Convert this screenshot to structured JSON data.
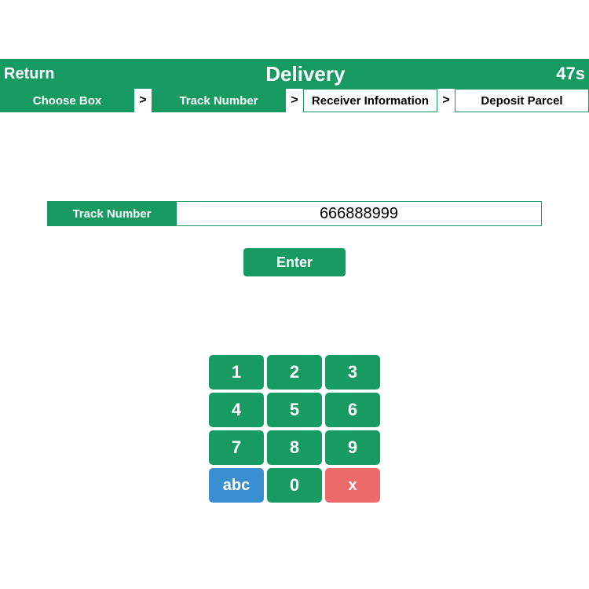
{
  "header": {
    "return_label": "Return",
    "title": "Delivery",
    "timer": "47s"
  },
  "breadcrumb": {
    "sep": ">",
    "steps": [
      {
        "label": "Choose Box",
        "state": "active"
      },
      {
        "label": "Track Number",
        "state": "active"
      },
      {
        "label": "Receiver Information",
        "state": "pending"
      },
      {
        "label": "Deposit Parcel",
        "state": "pending"
      }
    ]
  },
  "input": {
    "label": "Track Number",
    "value": "666888999"
  },
  "enter_label": "Enter",
  "keypad": {
    "k1": "1",
    "k2": "2",
    "k3": "3",
    "k4": "4",
    "k5": "5",
    "k6": "6",
    "k7": "7",
    "k8": "8",
    "k9": "9",
    "alpha": "abc",
    "k0": "0",
    "del": "x"
  }
}
